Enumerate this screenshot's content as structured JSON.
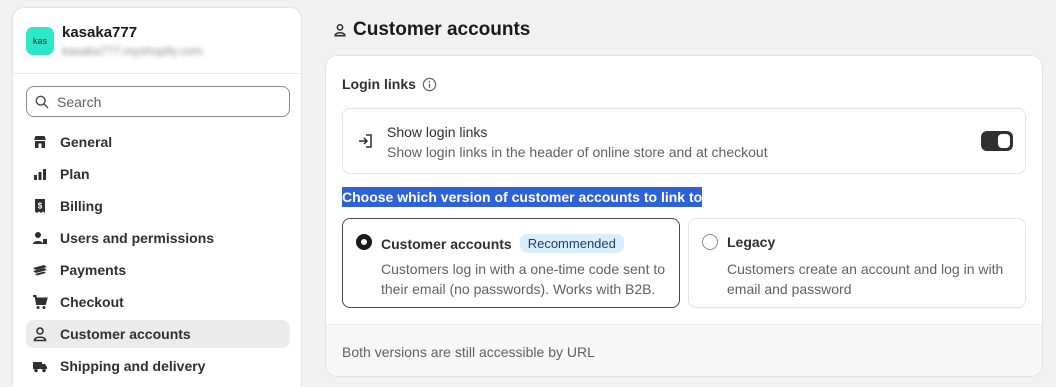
{
  "store": {
    "avatar_text": "kas",
    "name": "kasaka777",
    "url": "kasaka777.myshopify.com"
  },
  "search": {
    "placeholder": "Search"
  },
  "sidebar": {
    "items": [
      {
        "label": "General",
        "icon": "store-icon"
      },
      {
        "label": "Plan",
        "icon": "plan-icon"
      },
      {
        "label": "Billing",
        "icon": "billing-icon"
      },
      {
        "label": "Users and permissions",
        "icon": "users-icon"
      },
      {
        "label": "Payments",
        "icon": "payments-icon"
      },
      {
        "label": "Checkout",
        "icon": "cart-icon"
      },
      {
        "label": "Customer accounts",
        "icon": "person-icon",
        "active": true
      },
      {
        "label": "Shipping and delivery",
        "icon": "truck-icon"
      }
    ]
  },
  "page": {
    "title": "Customer accounts"
  },
  "login_links": {
    "title": "Login links",
    "toggle_label": "Show login links",
    "toggle_description": "Show login links in the header of online store and at checkout",
    "toggle_on": true
  },
  "version": {
    "prompt": "Choose which version of customer accounts to link to",
    "options": [
      {
        "title": "Customer accounts",
        "badge": "Recommended",
        "description": "Customers log in with a one-time code sent to their email (no passwords). Works with B2B.",
        "selected": true
      },
      {
        "title": "Legacy",
        "description": "Customers create an account and log in with email and password",
        "selected": false
      }
    ]
  },
  "footer": {
    "note": "Both versions are still accessible by URL"
  },
  "colors": {
    "accent": "#2ee6c8",
    "highlight": "#2f62d8",
    "badge_bg": "#d9eefb"
  }
}
